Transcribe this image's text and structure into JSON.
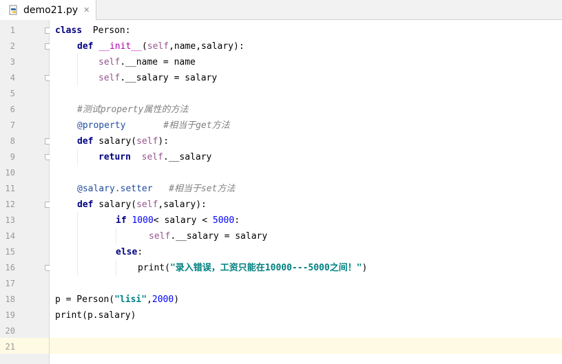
{
  "tab": {
    "file_name": "demo21.py",
    "close_glyph": "✕"
  },
  "editor": {
    "line_numbers": [
      "1",
      "2",
      "3",
      "4",
      "5",
      "6",
      "7",
      "8",
      "9",
      "10",
      "11",
      "12",
      "13",
      "14",
      "15",
      "16",
      "17",
      "18",
      "19",
      "20",
      "21"
    ],
    "lines": {
      "l1": {
        "kw": "class",
        "rest": "  Person:"
      },
      "l2": {
        "kw": "def",
        "sp": " ",
        "magic": "__init__",
        "rest1": "(",
        "self": "self",
        "rest2": ",name,salary):"
      },
      "l3": {
        "self": "self",
        "rest": ".__name = name"
      },
      "l4": {
        "self": "self",
        "rest": ".__salary = salary"
      },
      "l6": {
        "cm1": "#测试",
        "cm2": "property",
        "cm3": "属性的方法"
      },
      "l7": {
        "deco": "@property",
        "gap": "       ",
        "cm1": "#相当于",
        "cm2": "get",
        "cm3": "方法"
      },
      "l8": {
        "kw": "def",
        "rest1": " salary(",
        "self": "self",
        "rest2": "):"
      },
      "l9": {
        "kw": "return",
        "gap": "  ",
        "self": "self",
        "rest": ".__salary"
      },
      "l11": {
        "deco": "@salary.setter",
        "gap": "   ",
        "cm1": "#相当于",
        "cm2": "set",
        "cm3": "方法"
      },
      "l12": {
        "kw": "def",
        "rest1": " salary(",
        "self": "self",
        "rest2": ",salary):"
      },
      "l13": {
        "kw": "if",
        "sp": " ",
        "num1": "1000",
        "rest1": "< salary < ",
        "num2": "5000",
        "rest2": ":"
      },
      "l14": {
        "self": "self",
        "rest": ".__salary = salary"
      },
      "l15": {
        "kw": "else",
        "rest": ":"
      },
      "l16": {
        "fn": "print(",
        "str": "\"录入错误，工资只能在10000---5000之间！\"",
        "rest": ")"
      },
      "l18": {
        "rest1": "p = Person(",
        "str": "\"lisi\"",
        "rest2": ",",
        "num": "2000",
        "rest3": ")"
      },
      "l19": {
        "rest": "print(p.salary)"
      }
    }
  },
  "colors": {
    "keyword": "#000080",
    "self": "#94558d",
    "comment": "#808080",
    "decorator": "#1f4b9f",
    "number": "#0000ff",
    "string": "#008080",
    "magic": "#b200b2",
    "current_line": "#fffae3"
  }
}
